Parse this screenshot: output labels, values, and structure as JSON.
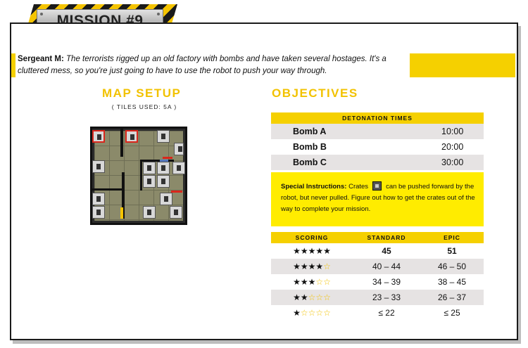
{
  "mission": {
    "title": "MISSION #9"
  },
  "intro": {
    "speaker": "Sergeant M:",
    "text": "The terrorists rigged up an old factory with bombs and have taken several hostages. It's a cluttered mess, so you're just going to have to use the robot to push your way through."
  },
  "map_setup": {
    "heading": "MAP SETUP",
    "tiles_used": "( TILES USED: 5A )"
  },
  "objectives": {
    "heading": "OBJECTIVES",
    "detonation_header": "DETONATION TIMES",
    "bombs": [
      {
        "name": "Bomb A",
        "time": "10:00"
      },
      {
        "name": "Bomb B",
        "time": "20:00"
      },
      {
        "name": "Bomb C",
        "time": "30:00"
      }
    ]
  },
  "special": {
    "label": "Special Instructions:",
    "before": "Crates",
    "icon": "crate-icon",
    "after": "can be pushed forward by the robot, but never pulled. Figure out how to get the crates out of the way to complete your mission."
  },
  "scoring": {
    "headers": [
      "SCORING",
      "STANDARD",
      "EPIC"
    ],
    "rows": [
      {
        "stars": 5,
        "standard": "45",
        "epic": "51"
      },
      {
        "stars": 4,
        "standard": "40 – 44",
        "epic": "46 – 50"
      },
      {
        "stars": 3,
        "standard": "34 – 39",
        "epic": "38 – 45"
      },
      {
        "stars": 2,
        "standard": "23 – 33",
        "epic": "26 – 37"
      },
      {
        "stars": 1,
        "standard": "≤ 22",
        "epic": "≤ 25"
      }
    ]
  },
  "colors": {
    "accent": "#f5d000",
    "highlight": "#ffec00",
    "row_shade": "#e6e3e3",
    "hazard_red": "#d9261c"
  }
}
